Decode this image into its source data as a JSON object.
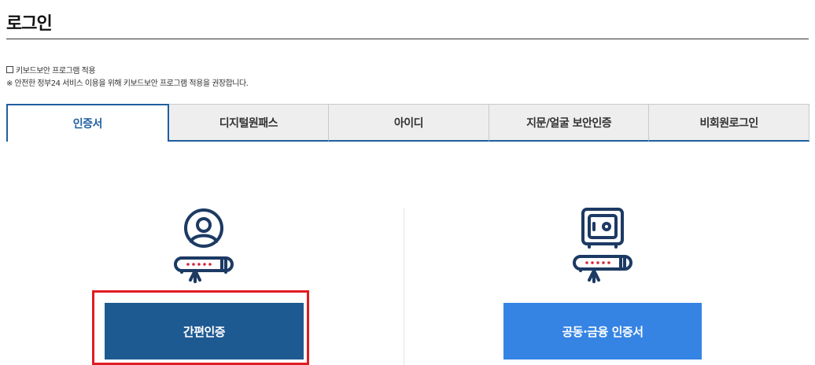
{
  "page": {
    "title": "로그인"
  },
  "keyboard_security": {
    "checkbox_label": "키보드보안 프로그램 적용",
    "checked": false,
    "notice": "※ 안전한 정부24 서비스 이용을 위해 키보드보안 프로그램 적용을 권장합니다."
  },
  "tabs": [
    {
      "label": "인증서",
      "active": true
    },
    {
      "label": "디지털원패스",
      "active": false
    },
    {
      "label": "아이디",
      "active": false
    },
    {
      "label": "지문/얼굴 보안인증",
      "active": false
    },
    {
      "label": "비회원로그인",
      "active": false
    }
  ],
  "options": {
    "simple": {
      "button_label": "간편인증",
      "icon": "user-password-icon",
      "color": "#1e5a92"
    },
    "joint": {
      "button_label": "공동·금융 인증서",
      "icon": "safe-password-icon",
      "color": "#3584e4"
    }
  },
  "colors": {
    "accent": "#1f5fa0",
    "icon_navy": "#1c3a63",
    "icon_red": "#d7263d",
    "highlight": "#e01b22"
  }
}
